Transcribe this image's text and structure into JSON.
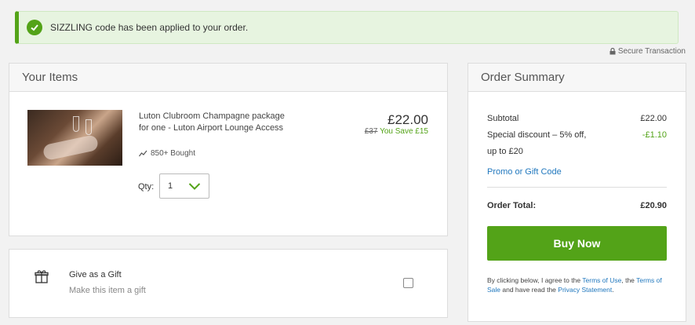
{
  "alert": {
    "message": "SIZZLING code has been applied to your order."
  },
  "secure": {
    "label": "Secure Transaction"
  },
  "items": {
    "heading": "Your Items",
    "product": {
      "title": "Luton Clubroom Champagne package for one - Luton Airport Lounge Access",
      "bought": "850+ Bought",
      "price": "£22.00",
      "was_price": "£37",
      "savings": "You Save £15"
    },
    "qty": {
      "label": "Qty:",
      "value": "1"
    }
  },
  "gift": {
    "title": "Give as a Gift",
    "subtitle": "Make this item a gift",
    "checked": false
  },
  "summary": {
    "heading": "Order Summary",
    "subtotal_label": "Subtotal",
    "subtotal_value": "£22.00",
    "discount_label_1": "Special discount – 5% off,",
    "discount_label_2": "up to £20",
    "discount_value": "-£1.10",
    "promo_link": "Promo or Gift Code",
    "total_label": "Order Total:",
    "total_value": "£20.90",
    "buy_label": "Buy Now",
    "legal": {
      "prefix": "By clicking below, I agree to the ",
      "terms_of_use": "Terms of Use",
      "mid1": ", the ",
      "terms_of_sale": "Terms of Sale",
      "mid2": " and have read the ",
      "privacy": "Privacy Statement",
      "suffix": "."
    }
  },
  "colors": {
    "accent": "#53a318",
    "link": "#2178be"
  }
}
